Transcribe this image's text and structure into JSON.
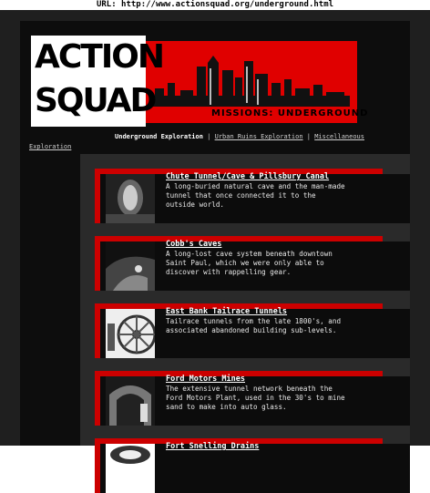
{
  "url_bar": "URL: http://www.actionsquad.org/underground.html",
  "logo": {
    "line1": "ACTION",
    "line2": "SQUAD",
    "subtitle": "MISSIONS: UNDERGROUND"
  },
  "nav": {
    "current": "Underground Exploration",
    "separator": "|",
    "link_urban": "Urban Ruins Exploration",
    "link_misc_part1": "Miscellaneous",
    "link_misc_part2": "Exploration"
  },
  "cards": [
    {
      "title": "Chute Tunnel/Cave & Pillsbury Canal",
      "description": "A long-buried natural cave and the man-made tunnel that once connected it to the outside world."
    },
    {
      "title": "Cobb's Caves",
      "description": "A long-lost cave system beneath downtown Saint Paul, which we were only able to discover with rappelling gear."
    },
    {
      "title": "East Bank Tailrace Tunnels",
      "description": "Tailrace tunnels from the late 1800's, and associated abandoned building sub-levels."
    },
    {
      "title": "Ford Motors Mines",
      "description": "The extensive tunnel network beneath the Ford Motors Plant, used in the 30's to mine sand to make into auto glass."
    },
    {
      "title": "Fort Snelling Drains",
      "description": ""
    }
  ],
  "colors": {
    "accent_red": "#cc0000",
    "page_bg": "#1f1f1f",
    "panel_bg": "#0d0d0d"
  }
}
